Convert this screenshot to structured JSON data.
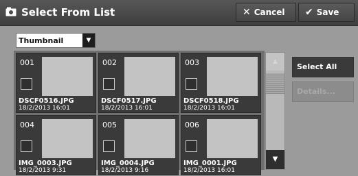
{
  "header": {
    "title": "Select From List",
    "cancel_label": "Cancel",
    "save_label": "Save"
  },
  "view_mode": {
    "selected": "Thumbnail"
  },
  "files": [
    {
      "number": "001",
      "name": "DSCF0516.JPG",
      "date": "18/2/2013 16:01"
    },
    {
      "number": "002",
      "name": "DSCF0517.JPG",
      "date": "18/2/2013 16:01"
    },
    {
      "number": "003",
      "name": "DSCF0518.JPG",
      "date": "18/2/2013 16:01"
    },
    {
      "number": "004",
      "name": "IMG_0003.JPG",
      "date": "18/2/2013 9:31"
    },
    {
      "number": "005",
      "name": "IMG_0004.JPG",
      "date": "18/2/2013 9:16"
    },
    {
      "number": "006",
      "name": "IMG_0001.JPG",
      "date": "18/2/2013 16:01"
    }
  ],
  "actions": {
    "select_all_label": "Select All",
    "details_label": "Details..."
  }
}
